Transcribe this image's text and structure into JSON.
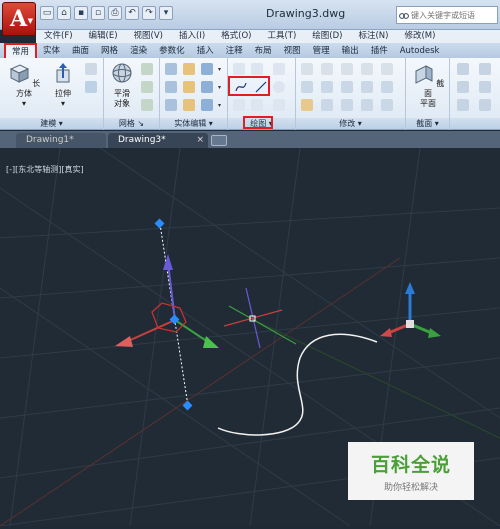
{
  "window": {
    "title": "Drawing3.dwg"
  },
  "search": {
    "placeholder": "键入关键字或短语"
  },
  "menu": [
    "文件(F)",
    "编辑(E)",
    "视图(V)",
    "插入(I)",
    "格式(O)",
    "工具(T)",
    "绘图(D)",
    "标注(N)",
    "修改(M)"
  ],
  "ribbon_tabs": [
    "常用",
    "实体",
    "曲面",
    "网格",
    "渲染",
    "参数化",
    "插入",
    "注释",
    "布局",
    "视图",
    "管理",
    "输出",
    "插件",
    "Autodesk"
  ],
  "ribbon": {
    "box_label": "长方体",
    "extrude_label": "拉伸",
    "smooth_label_1": "平滑",
    "smooth_label_2": "对象",
    "section_label_1": "截面",
    "section_label_2": "平面",
    "panels": {
      "modeling": "建模",
      "mesh": "网格",
      "solid_edit": "实体编辑",
      "draw": "绘图",
      "modify": "修改",
      "section": "截面"
    }
  },
  "doc_tabs": [
    "Drawing1*",
    "Drawing3*"
  ],
  "viewport": {
    "label": "[-][东北等轴测][真实]"
  },
  "watermark": {
    "title": "百科全说",
    "subtitle": "助你轻松解决"
  },
  "colors": {
    "accent_red": "#e02020",
    "viewport_bg": "#212b36",
    "watermark_green": "#4aa036"
  }
}
